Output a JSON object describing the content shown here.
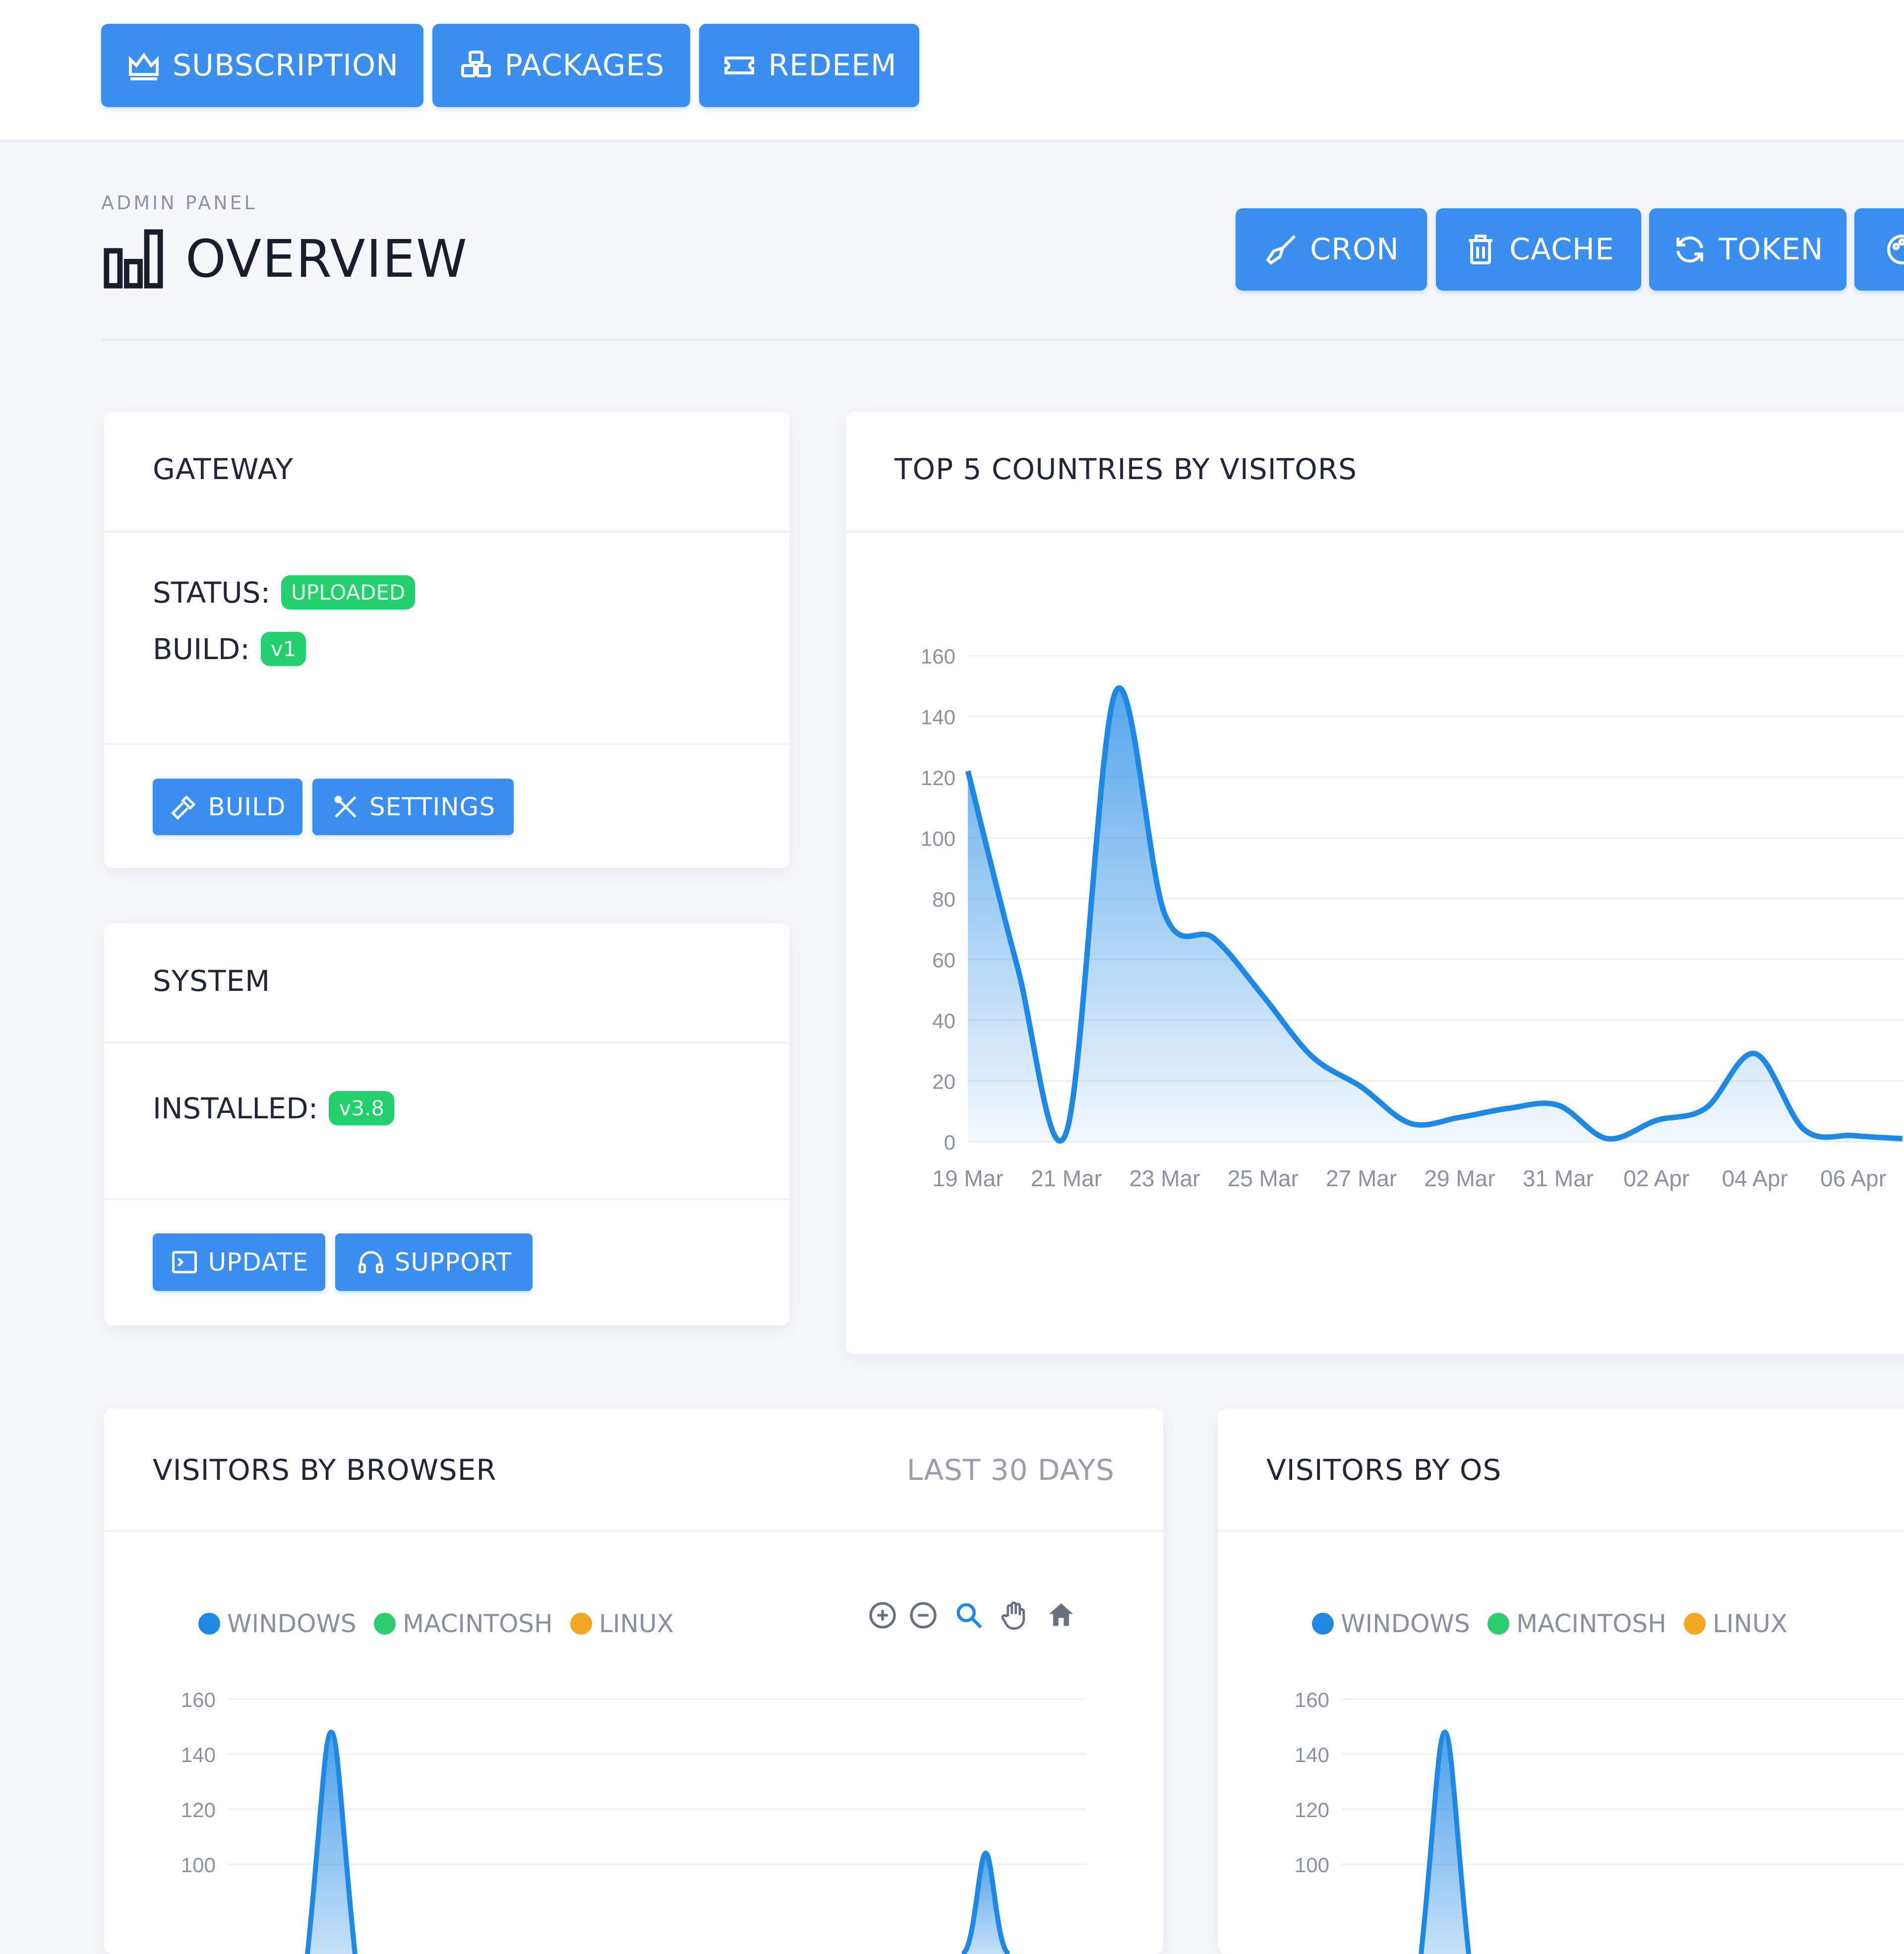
{
  "topbar": {
    "buttons": [
      {
        "label": "SUBSCRIPTION",
        "icon": "crown-icon"
      },
      {
        "label": "PACKAGES",
        "icon": "cubes-icon"
      },
      {
        "label": "REDEEM",
        "icon": "ticket-icon"
      }
    ]
  },
  "header": {
    "breadcrumb": "ADMIN PANEL",
    "title": "OVERVIEW",
    "title_icon": "bar-chart-icon",
    "actions": [
      {
        "label": "CRON",
        "icon": "broom-icon"
      },
      {
        "label": "CACHE",
        "icon": "trash-icon"
      },
      {
        "label": "TOKEN",
        "icon": "refresh-icon"
      }
    ]
  },
  "gateway": {
    "title": "GATEWAY",
    "status_label": "STATUS:",
    "status_value": "UPLOADED",
    "build_label": "BUILD:",
    "build_value": "v1",
    "buttons": [
      {
        "label": "BUILD",
        "icon": "hammer-icon"
      },
      {
        "label": "SETTINGS",
        "icon": "tools-icon"
      }
    ]
  },
  "system": {
    "title": "SYSTEM",
    "installed_label": "INSTALLED:",
    "installed_value": "v3.8",
    "buttons": [
      {
        "label": "UPDATE",
        "icon": "terminal-icon"
      },
      {
        "label": "SUPPORT",
        "icon": "headset-icon"
      }
    ]
  },
  "countries": {
    "title": "TOP 5 COUNTRIES BY VISITORS"
  },
  "browser": {
    "title": "VISITORS BY BROWSER",
    "range": "LAST 30 DAYS",
    "legend": [
      "WINDOWS",
      "MACINTOSH",
      "LINUX"
    ],
    "toolbar": [
      "zoom-in-icon",
      "zoom-out-icon",
      "selection-zoom-icon",
      "pan-hand-icon",
      "reset-home-icon"
    ]
  },
  "os": {
    "title": "VISITORS BY OS",
    "legend": [
      "WINDOWS",
      "MACINTOSH",
      "LINUX"
    ]
  },
  "colors": {
    "accent": "#3a8ef0",
    "success": "#24cf6e",
    "windows": "#1e88e5",
    "macintosh": "#2ecc71",
    "linux": "#f5a623"
  },
  "chart_data": [
    {
      "type": "area",
      "title": "TOP 5 COUNTRIES BY VISITORS",
      "x": [
        "19 Mar",
        "20 Mar",
        "21 Mar",
        "22 Mar",
        "23 Mar",
        "24 Mar",
        "25 Mar",
        "26 Mar",
        "27 Mar",
        "28 Mar",
        "29 Mar",
        "30 Mar",
        "31 Mar",
        "01 Apr",
        "02 Apr",
        "03 Apr",
        "04 Apr",
        "05 Apr",
        "06 Apr",
        "07 Apr"
      ],
      "x_tick_labels": [
        "19 Mar",
        "21 Mar",
        "23 Mar",
        "25 Mar",
        "27 Mar",
        "29 Mar",
        "31 Mar",
        "02 Apr",
        "04 Apr",
        "06 Apr"
      ],
      "series": [
        {
          "values": [
            122,
            58,
            3,
            148,
            75,
            67,
            48,
            28,
            18,
            6,
            8,
            11,
            12,
            1,
            7,
            11,
            29,
            4,
            2,
            1
          ]
        }
      ],
      "ylim": [
        0,
        160
      ],
      "y_ticks": [
        0,
        20,
        40,
        60,
        80,
        100,
        120,
        140,
        160
      ],
      "grid": true
    },
    {
      "type": "area",
      "title": "VISITORS BY BROWSER",
      "legend": [
        "WINDOWS",
        "MACINTOSH",
        "LINUX"
      ],
      "y_ticks_visible": [
        100,
        120,
        140,
        160
      ],
      "visible_peaks": [
        148,
        104
      ]
    },
    {
      "type": "area",
      "title": "VISITORS BY OS",
      "legend": [
        "WINDOWS",
        "MACINTOSH",
        "LINUX"
      ],
      "y_ticks_visible": [
        100,
        120,
        140,
        160
      ],
      "visible_peaks": [
        148
      ]
    }
  ]
}
